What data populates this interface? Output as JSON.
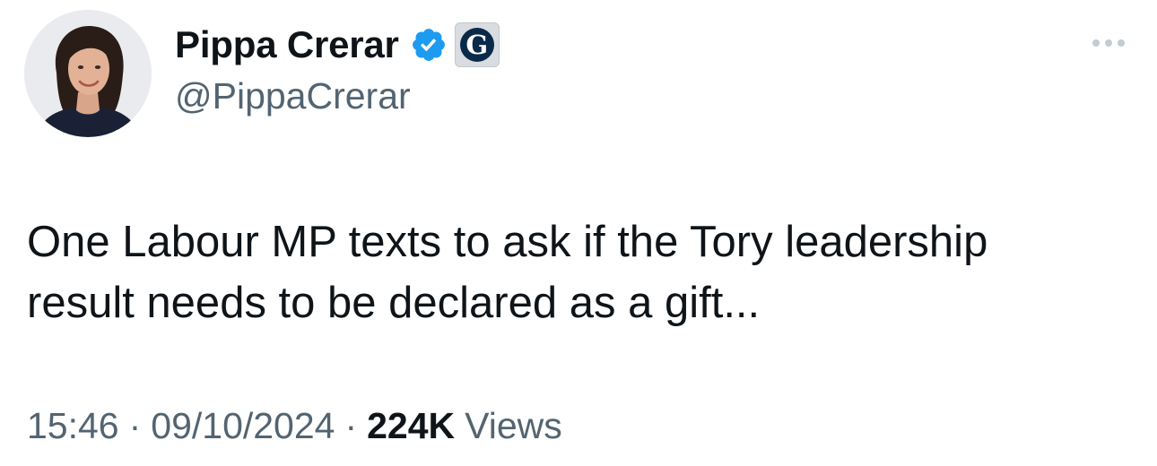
{
  "author": {
    "display_name": "Pippa Crerar",
    "handle": "@PippaCrerar",
    "verified_color": "#1d9bf0",
    "affiliate_letter": "G",
    "avatar_icon": "person-photo-icon",
    "verified_icon": "verified-checkmark-icon",
    "affiliate_icon": "guardian-logo-icon"
  },
  "tweet": {
    "text": "One Labour MP texts to ask if the Tory leadership\nresult needs to be declared as a gift..."
  },
  "meta": {
    "time": "15:46",
    "separator": "·",
    "date": "09/10/2024",
    "views_count": "224K",
    "views_label": "Views"
  },
  "actions": {
    "more_icon": "more-options-icon"
  }
}
